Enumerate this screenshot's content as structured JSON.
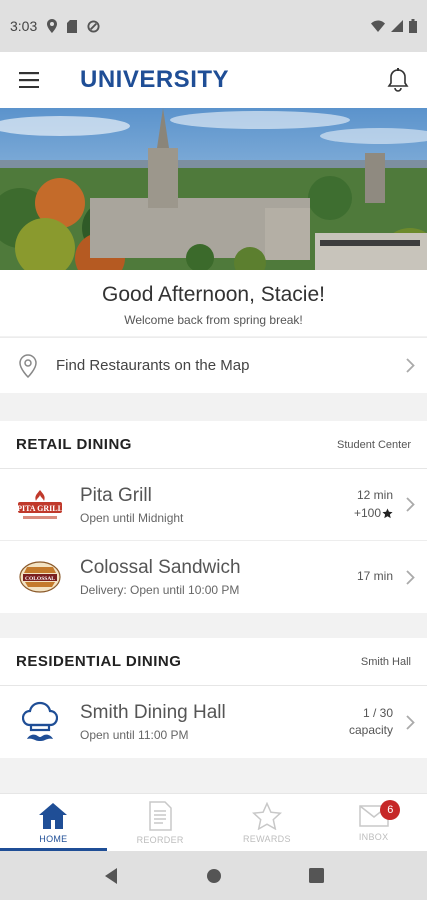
{
  "status": {
    "time": "3:03"
  },
  "app": {
    "title": "UNIVERSITY"
  },
  "greeting": {
    "title": "Good Afternoon, Stacie!",
    "subtitle": "Welcome back from spring break!"
  },
  "map_link": {
    "label": "Find Restaurants on the Map"
  },
  "retail": {
    "title": "RETAIL DINING",
    "location": "Student Center",
    "items": [
      {
        "name": "Pita Grill",
        "status": "Open until Midnight",
        "time": "12 min",
        "points": "+100",
        "logo": "pita-grill-logo"
      },
      {
        "name": "Colossal Sandwich",
        "status": "Delivery: Open until 10:00 PM",
        "time": "17 min",
        "logo": "colossal-sandwich-logo"
      }
    ]
  },
  "residential": {
    "title": "RESIDENTIAL DINING",
    "location": "Smith Hall",
    "items": [
      {
        "name": "Smith Dining Hall",
        "status": "Open until 11:00 PM",
        "capacity_value": "1 / 30",
        "capacity_label": "capacity",
        "logo": "chef-icon"
      }
    ]
  },
  "nav": {
    "items": [
      {
        "label": "HOME",
        "icon": "home-icon",
        "active": true
      },
      {
        "label": "REORDER",
        "icon": "receipt-icon"
      },
      {
        "label": "REWARDS",
        "icon": "star-icon"
      },
      {
        "label": "INBOX",
        "icon": "mail-icon",
        "badge": "6"
      }
    ]
  },
  "colors": {
    "brand": "#1f4e96",
    "badge": "#c62828"
  }
}
